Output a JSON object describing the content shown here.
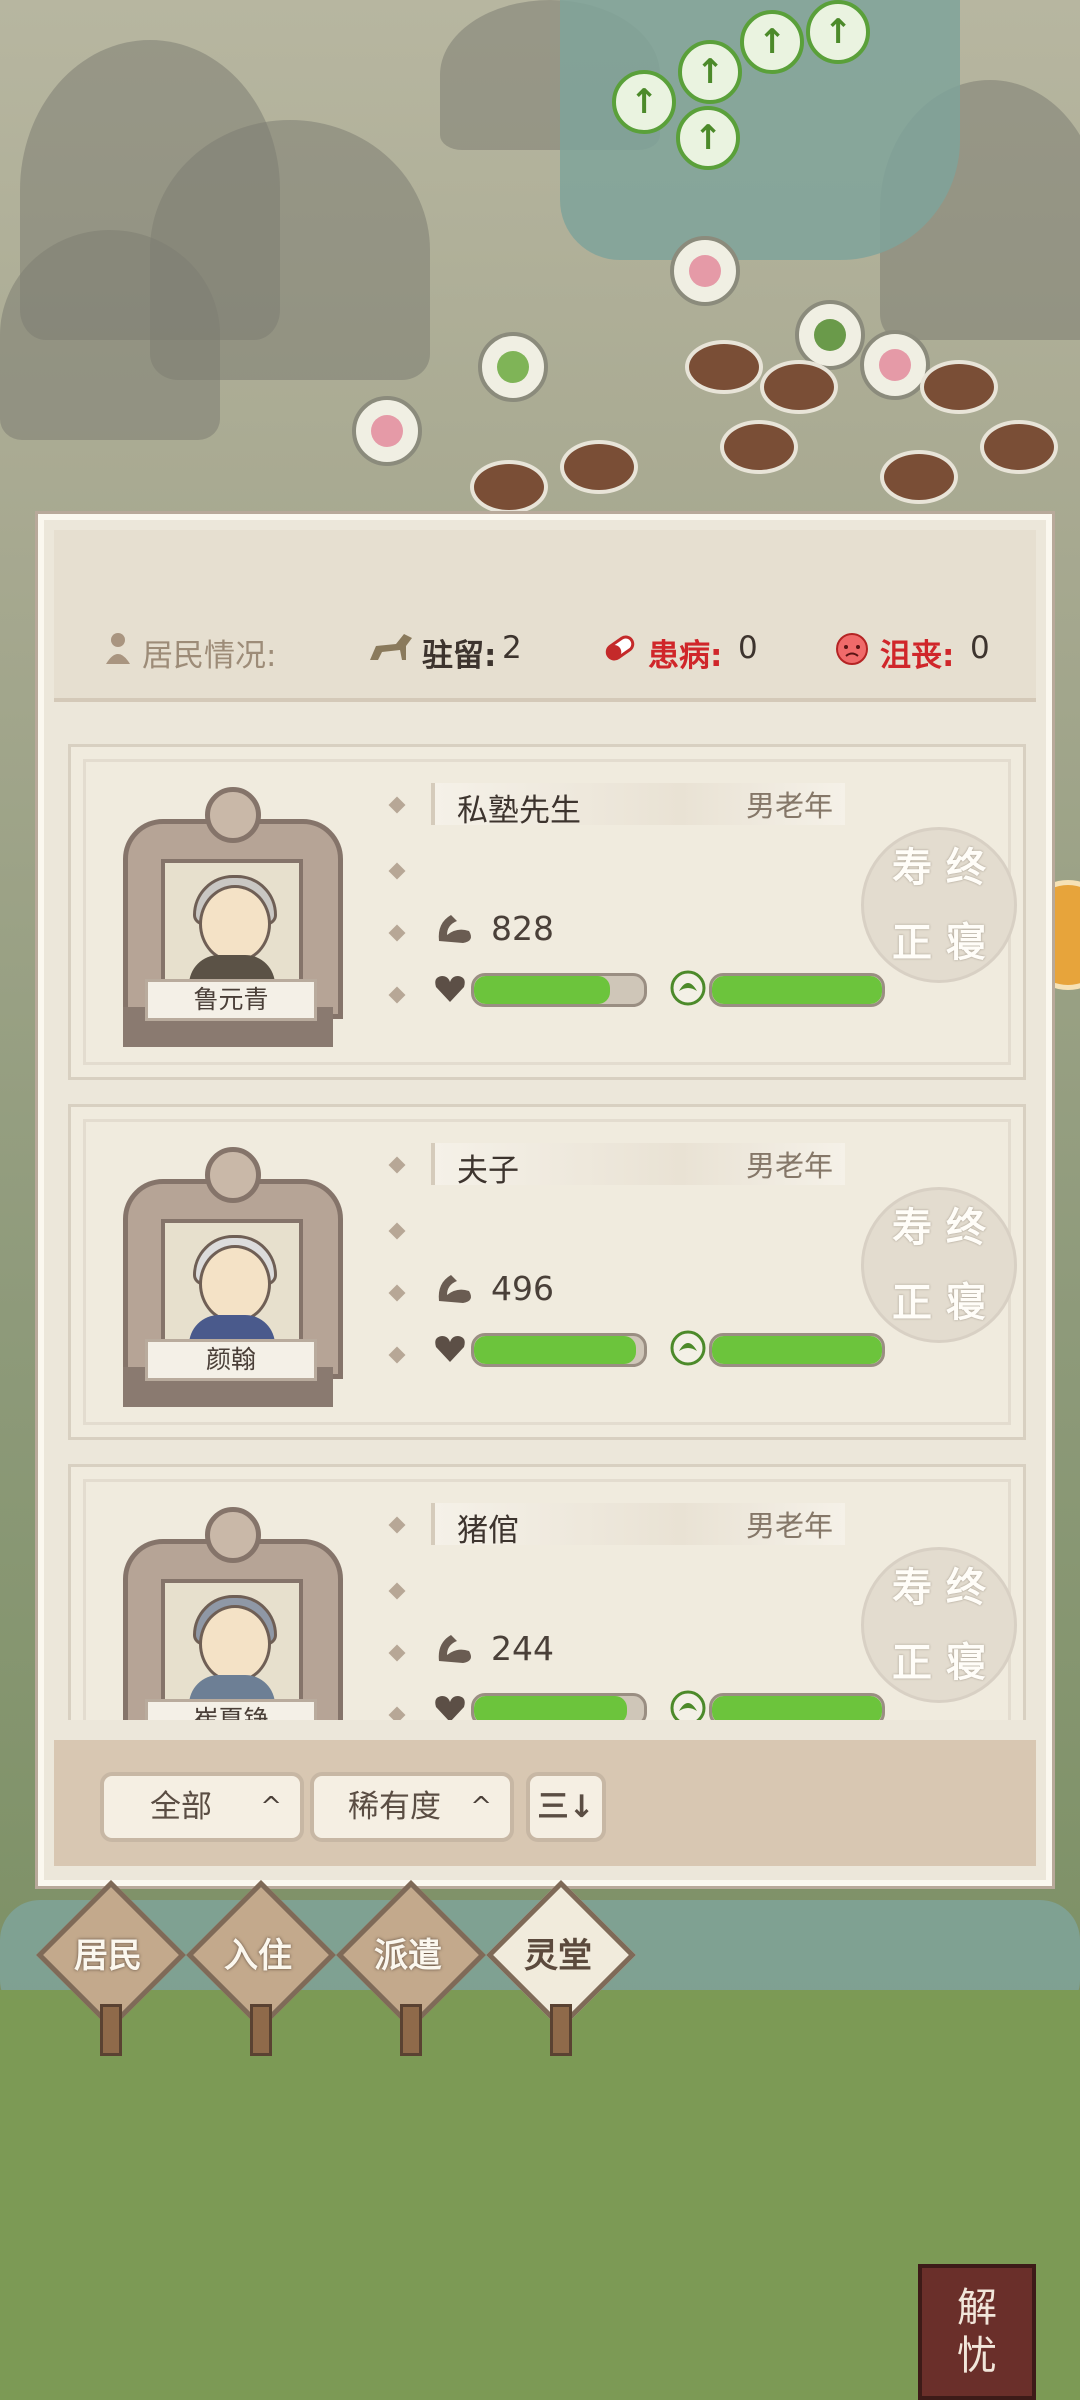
{
  "header": {
    "label": "居民情况:",
    "stay_label": "驻留:",
    "stay_value": "2",
    "sick_label": "患病:",
    "sick_value": "0",
    "sad_label": "沮丧:",
    "sad_value": "0"
  },
  "residents": [
    {
      "name": "鲁元青",
      "title": "私塾先生",
      "gender": "男老年",
      "value": "828",
      "health": 0.8,
      "spirit": 1.0,
      "stamp": [
        "寿",
        "终",
        "正",
        "寝"
      ]
    },
    {
      "name": "颜翰",
      "title": "夫子",
      "gender": "男老年",
      "value": "496",
      "health": 0.95,
      "spirit": 1.0,
      "stamp": [
        "寿",
        "终",
        "正",
        "寝"
      ]
    },
    {
      "name": "崔夏铮",
      "title": "猪倌",
      "gender": "男老年",
      "value": "244",
      "health": 0.9,
      "spirit": 1.0,
      "stamp": [
        "寿",
        "终",
        "正",
        "寝"
      ]
    }
  ],
  "footer": {
    "filter_all": "全部",
    "sort_rarity": "稀有度",
    "caret": "^",
    "sort_icon": "三↓"
  },
  "tabs": [
    {
      "label": "居民",
      "active": false
    },
    {
      "label": "入住",
      "active": false
    },
    {
      "label": "派遣",
      "active": false
    },
    {
      "label": "灵堂",
      "active": true
    }
  ],
  "seal": {
    "line1": "解",
    "line2": "忧"
  },
  "colors": {
    "sick": "#d0262a",
    "sad": "#d0262a",
    "bar_fill": "#6cc43c"
  }
}
